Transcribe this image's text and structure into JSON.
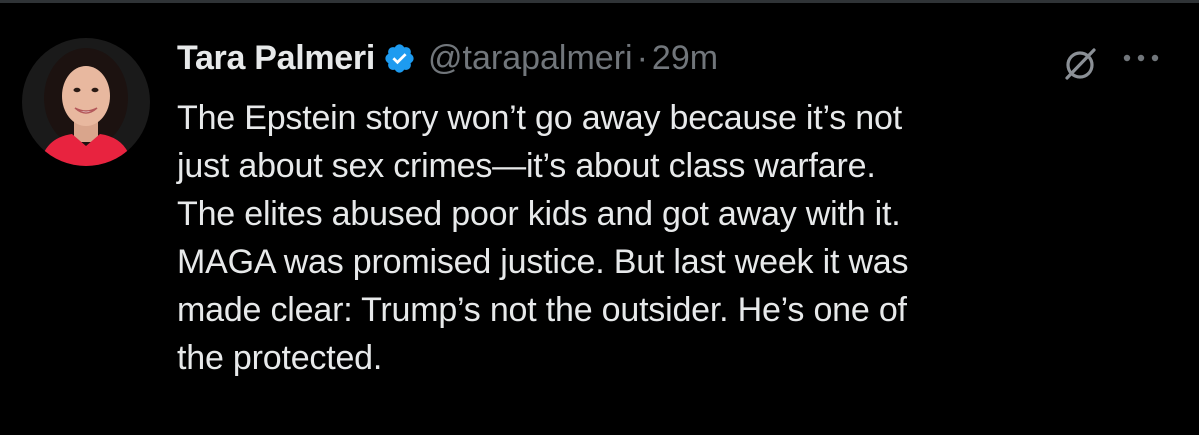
{
  "tweet": {
    "author": {
      "display_name": "Tara Palmeri",
      "handle": "@tarapalmeri",
      "verified": true,
      "verified_color": "#1d9bf0",
      "avatar_icon": "profile-photo"
    },
    "separator": "·",
    "timestamp": "29m",
    "text": "The Epstein story won’t go away because it’s not\njust about sex crimes—it’s about class warfare.\nThe elites abused poor kids and got away with it.\nMAGA was promised justice. But last week it was\nmade clear: Trump’s not the outsider. He’s one of\nthe protected.",
    "actions": {
      "grok_icon": "grok-icon",
      "more_icon": "more-options-icon"
    }
  },
  "colors": {
    "background": "#000000",
    "primary_text": "#e7e9ea",
    "secondary_text": "#71767b",
    "accent": "#1d9bf0"
  }
}
